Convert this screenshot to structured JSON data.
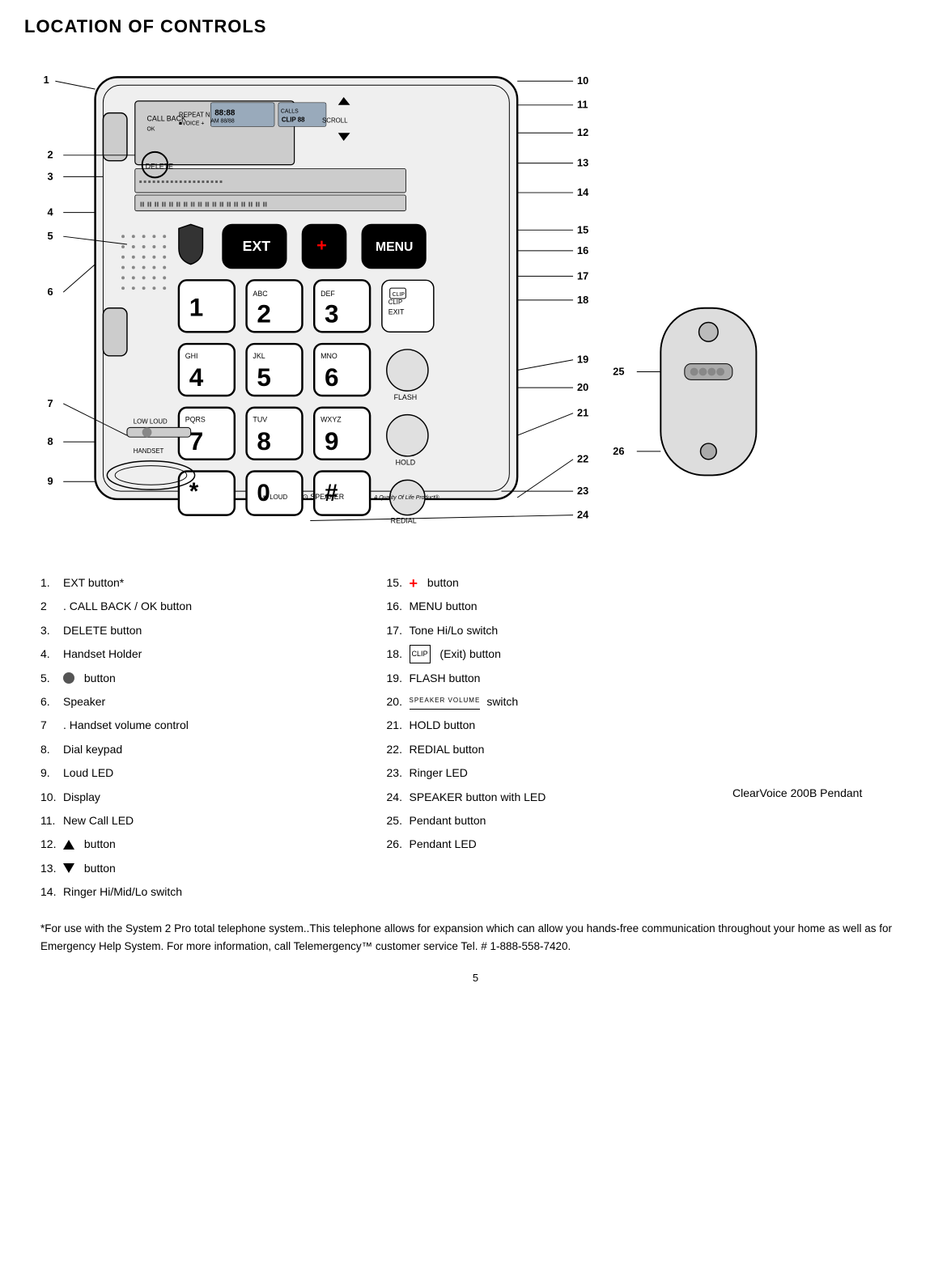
{
  "page": {
    "title": "LOCATION OF CONTROLS",
    "page_number": "5"
  },
  "diagram": {
    "left_labels": [
      "1",
      "2",
      "3",
      "4",
      "5",
      "6",
      "7",
      "8",
      "9"
    ],
    "right_labels": [
      "10",
      "11",
      "12",
      "13",
      "14",
      "15",
      "16",
      "17",
      "18",
      "19",
      "20",
      "21",
      "22",
      "23",
      "24"
    ],
    "pendant_labels": [
      "25",
      "26"
    ],
    "pendant_caption": "ClearVoice 200B Pendant"
  },
  "legend": {
    "col1": [
      {
        "num": "1.",
        "text": "EXT button*"
      },
      {
        "num": "2",
        "text": ". CALL BACK / OK button"
      },
      {
        "num": "3.",
        "text": "DELETE button"
      },
      {
        "num": "4.",
        "text": "Handset Holder"
      },
      {
        "num": "5.",
        "text": "button",
        "has_circle_icon": true
      },
      {
        "num": "6.",
        "text": "Speaker"
      },
      {
        "num": "7",
        "text": ". Handset volume control"
      },
      {
        "num": "8.",
        "text": "Dial keypad"
      },
      {
        "num": "9.",
        "text": "Loud LED"
      },
      {
        "num": "10.",
        "text": "Display"
      },
      {
        "num": "11.",
        "text": "New Call LED"
      },
      {
        "num": "12.",
        "text": "button",
        "has_tri_up": true
      },
      {
        "num": "13.",
        "text": "button",
        "has_tri_down": true
      },
      {
        "num": "14.",
        "text": "Ringer Hi/Mid/Lo switch"
      }
    ],
    "col2": [
      {
        "num": "15.",
        "text": "button",
        "has_plus": true
      },
      {
        "num": "16.",
        "text": "MENU button"
      },
      {
        "num": "17.",
        "text": "Tone Hi/Lo switch"
      },
      {
        "num": "18.",
        "text": "(Exit) button",
        "has_clip": true
      },
      {
        "num": "19.",
        "text": "FLASH button"
      },
      {
        "num": "20.",
        "text": "switch",
        "has_speaker_vol": true
      },
      {
        "num": "21.",
        "text": "HOLD button"
      },
      {
        "num": "22.",
        "text": "REDIAL button"
      },
      {
        "num": "23.",
        "text": "Ringer LED"
      },
      {
        "num": "24.",
        "text": "SPEAKER button with LED"
      },
      {
        "num": "25.",
        "text": "Pendant button"
      },
      {
        "num": "26.",
        "text": "Pendant LED"
      }
    ]
  },
  "footnote": {
    "text": "*For use with the System 2 Pro total telephone system..This telephone allows for expansion which can allow you hands-free  communication throughout your home as well as for Emergency Help System. For more information, call Telemergency™ customer service       Tel. #  1-888-558-7420."
  }
}
